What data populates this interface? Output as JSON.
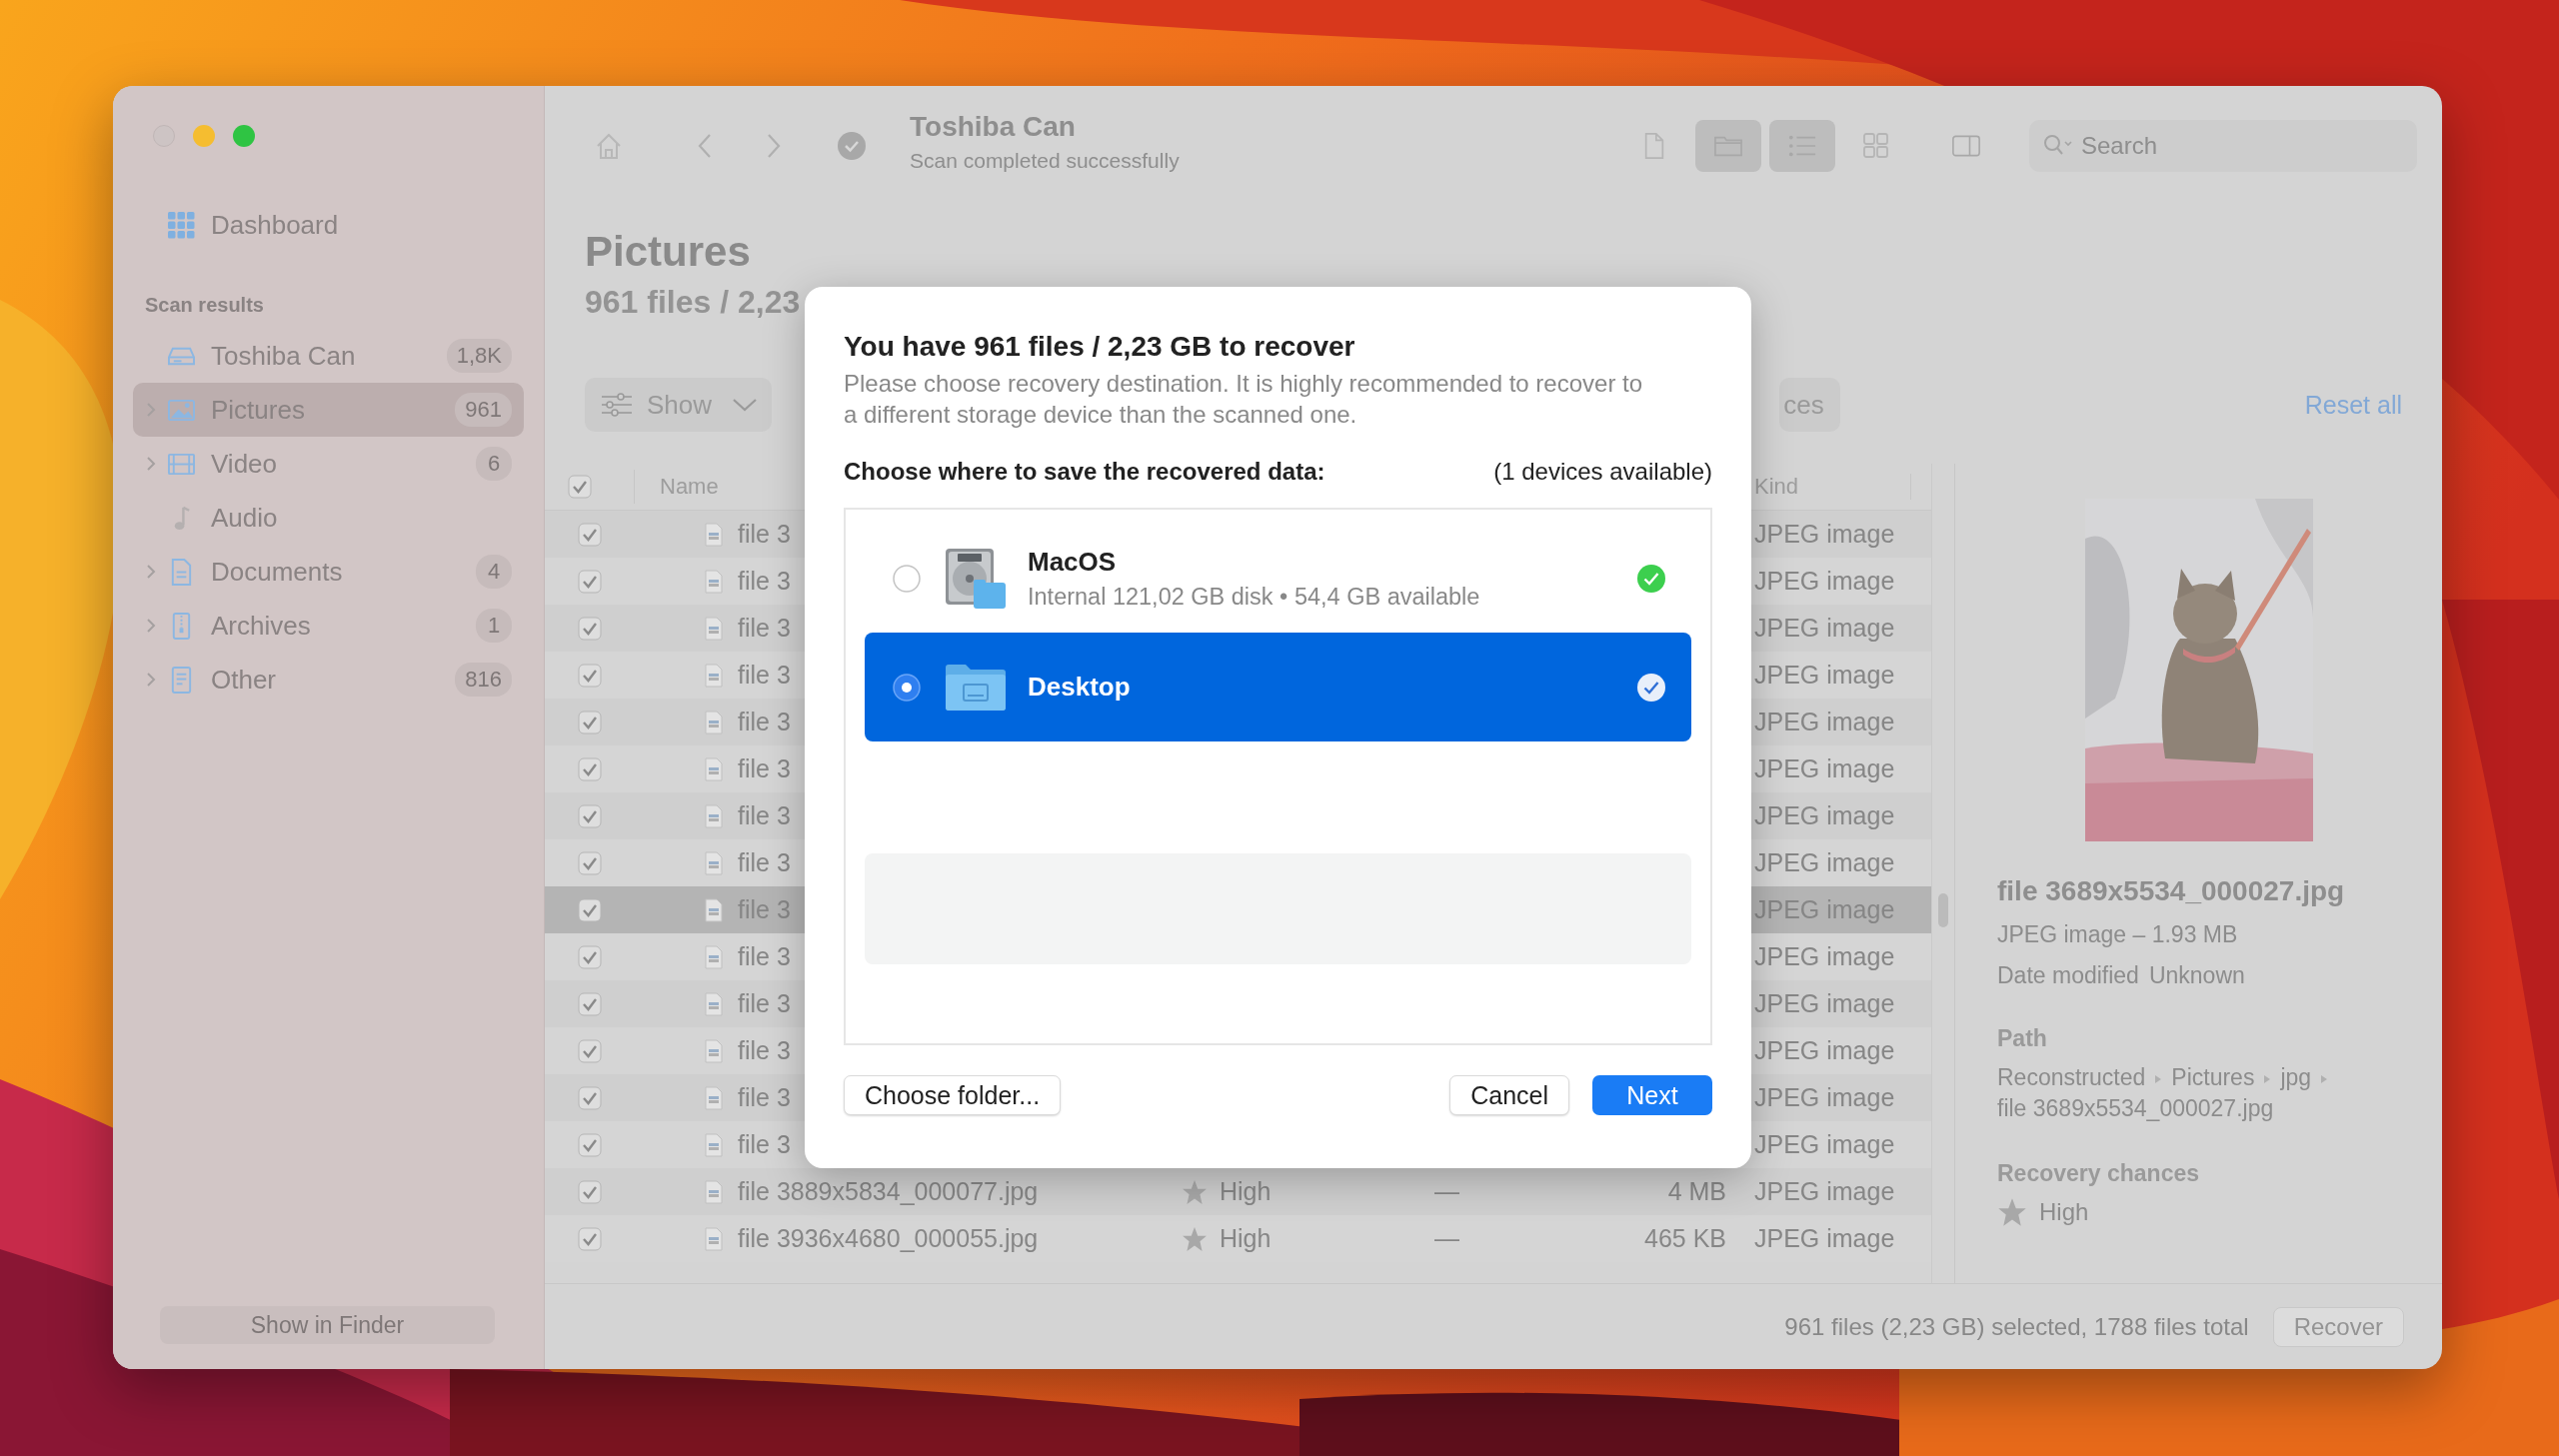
{
  "window": {
    "title": "Toshiba Can",
    "subtitle": "Scan completed successfully",
    "controls": [
      {
        "kind": "close",
        "disabled": true
      },
      {
        "kind": "minimize",
        "disabled": false
      },
      {
        "kind": "zoom",
        "disabled": false
      }
    ]
  },
  "toolbar": {
    "view_buttons": [
      {
        "kind": "file",
        "selected": false
      },
      {
        "kind": "folder",
        "selected": true
      },
      {
        "kind": "list",
        "selected": true
      },
      {
        "kind": "grid",
        "selected": false
      },
      {
        "kind": "sidebar",
        "selected": false
      }
    ],
    "search": {
      "placeholder": "Search"
    }
  },
  "sidebar": {
    "dashboard": "Dashboard",
    "section": "Scan results",
    "items": [
      {
        "label": "Toshiba Can",
        "count": "1,8K",
        "kind": "drive",
        "expandable": false,
        "selected": false
      },
      {
        "label": "Pictures",
        "count": "961",
        "kind": "pictures",
        "expandable": true,
        "selected": true
      },
      {
        "label": "Video",
        "count": "6",
        "kind": "video",
        "expandable": true,
        "selected": false
      },
      {
        "label": "Audio",
        "kind": "audio",
        "expandable": false,
        "selected": false
      },
      {
        "label": "Documents",
        "count": "4",
        "kind": "documents",
        "expandable": true,
        "selected": false
      },
      {
        "label": "Archives",
        "count": "1",
        "kind": "archives",
        "expandable": true,
        "selected": false
      },
      {
        "label": "Other",
        "count": "816",
        "kind": "other",
        "expandable": true,
        "selected": false
      }
    ],
    "footer_button": "Show in Finder"
  },
  "content": {
    "heading": "Pictures",
    "summary": "961 files / 2,23",
    "filter_button": "Show",
    "chip": "ces",
    "reset": "Reset all"
  },
  "table": {
    "header_checked": true,
    "columns": [
      "Name",
      "Kind"
    ],
    "rows": [
      {
        "checked": true,
        "selected": false,
        "name": "file 3",
        "kind": "JPEG image"
      },
      {
        "checked": true,
        "selected": false,
        "name": "file 3",
        "kind": "JPEG image"
      },
      {
        "checked": true,
        "selected": false,
        "name": "file 3",
        "kind": "JPEG image"
      },
      {
        "checked": true,
        "selected": false,
        "name": "file 3",
        "kind": "JPEG image"
      },
      {
        "checked": true,
        "selected": false,
        "name": "file 3",
        "kind": "JPEG image"
      },
      {
        "checked": true,
        "selected": false,
        "name": "file 3",
        "kind": "JPEG image"
      },
      {
        "checked": true,
        "selected": false,
        "name": "file 3",
        "kind": "JPEG image"
      },
      {
        "checked": true,
        "selected": false,
        "name": "file 3",
        "kind": "JPEG image"
      },
      {
        "checked": true,
        "selected": true,
        "name": "file 3",
        "kind": "JPEG image"
      },
      {
        "checked": true,
        "selected": false,
        "name": "file 3",
        "kind": "JPEG image"
      },
      {
        "checked": true,
        "selected": false,
        "name": "file 3",
        "kind": "JPEG image"
      },
      {
        "checked": true,
        "selected": false,
        "name": "file 3",
        "kind": "JPEG image"
      },
      {
        "checked": true,
        "selected": false,
        "name": "file 3",
        "kind": "JPEG image"
      },
      {
        "checked": true,
        "selected": false,
        "name": "file 3",
        "kind": "JPEG image"
      },
      {
        "checked": true,
        "selected": false,
        "name": "file 3889x5834_000077.jpg",
        "chance": "High",
        "status": "—",
        "size": "4 MB",
        "kind": "JPEG image"
      },
      {
        "checked": true,
        "selected": false,
        "name": "file 3936x4680_000055.jpg",
        "chance": "High",
        "status": "—",
        "size": "465 KB",
        "kind": "JPEG image"
      }
    ]
  },
  "preview": {
    "name": "file 3689x5534_000027.jpg",
    "meta": "JPEG image – 1.93 MB",
    "date_label": "Date modified",
    "date_value": "Unknown",
    "path_label": "Path",
    "path": [
      "Reconstructed",
      "Pictures",
      "jpg",
      "file 3689x5534_000027.jpg"
    ],
    "chances_label": "Recovery chances",
    "chances": "High"
  },
  "status_bar": {
    "text": "961 files (2,23 GB) selected, 1788 files total",
    "button": "Recover"
  },
  "dialog": {
    "title": "You have 961 files / 2,23 GB to recover",
    "description": "Please choose recovery destination. It is highly recommended to recover to a different storage device than the scanned one.",
    "prompt": "Choose where to save the recovered data:",
    "devices": "(1 devices available)",
    "destinations": [
      {
        "kind": "drive",
        "name": "MacOS",
        "detail": "Internal 121,02 GB disk • 54,4 GB available",
        "selected": false,
        "available": true
      },
      {
        "kind": "folder",
        "name": "Desktop",
        "selected": true,
        "available": true
      }
    ],
    "buttons": [
      {
        "label": "Choose folder...",
        "kind": "secondary"
      },
      {
        "label": "Cancel",
        "kind": "secondary"
      },
      {
        "label": "Next",
        "kind": "primary"
      }
    ]
  }
}
